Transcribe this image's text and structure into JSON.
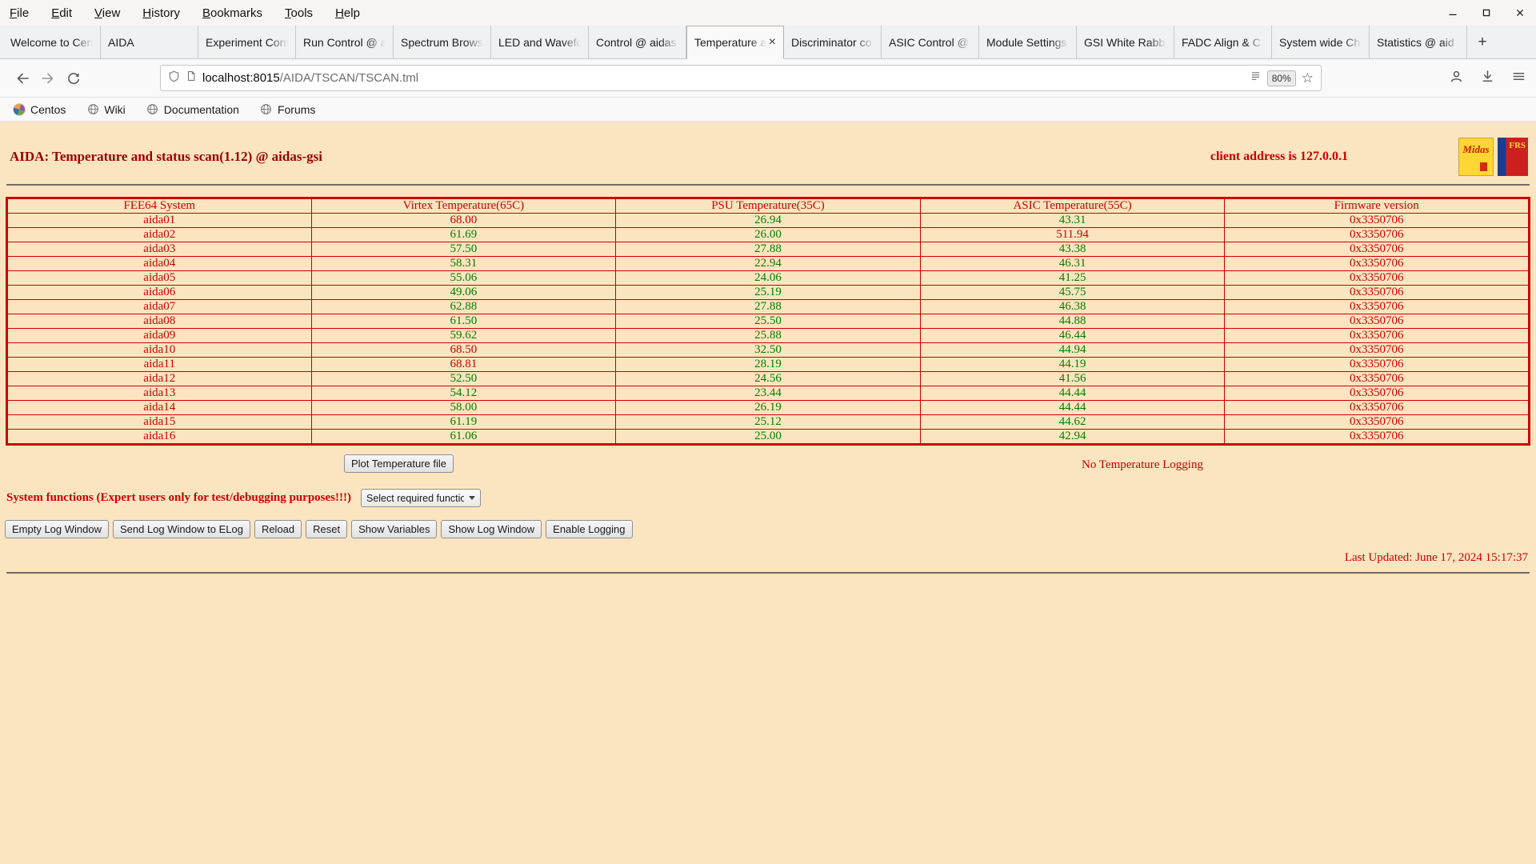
{
  "browser": {
    "menubar": {
      "items": [
        "File",
        "Edit",
        "View",
        "History",
        "Bookmarks",
        "Tools",
        "Help"
      ]
    },
    "tabs": [
      {
        "label": "Welcome to Cent",
        "active": false
      },
      {
        "label": "AIDA",
        "active": false
      },
      {
        "label": "Experiment Cont",
        "active": false
      },
      {
        "label": "Run Control @ a",
        "active": false
      },
      {
        "label": "Spectrum Brows",
        "active": false
      },
      {
        "label": "LED and Wavefo",
        "active": false
      },
      {
        "label": "Control @ aidas",
        "active": false
      },
      {
        "label": "Temperature an",
        "active": true
      },
      {
        "label": "Discriminator co",
        "active": false
      },
      {
        "label": "ASIC Control @",
        "active": false
      },
      {
        "label": "Module Settings",
        "active": false
      },
      {
        "label": "GSI White Rabb",
        "active": false
      },
      {
        "label": "FADC Align & C",
        "active": false
      },
      {
        "label": "System wide Ch",
        "active": false
      },
      {
        "label": "Statistics @ aid",
        "active": false
      }
    ],
    "new_tab_label": "+",
    "navbar": {
      "url_host": "localhost:8015",
      "url_path": "/AIDA/TSCAN/TSCAN.tml",
      "zoom": "80%"
    },
    "bookmarks": [
      {
        "label": "Centos",
        "icon": "centos"
      },
      {
        "label": "Wiki",
        "icon": "globe"
      },
      {
        "label": "Documentation",
        "icon": "globe"
      },
      {
        "label": "Forums",
        "icon": "globe"
      }
    ]
  },
  "page": {
    "title": "AIDA: Temperature and status scan(1.12) @ aidas-gsi",
    "client_address": "client address is 127.0.0.1",
    "logos": {
      "midas": "Midas",
      "frs": "FRS"
    },
    "table": {
      "headers": [
        "FEE64 System",
        "Virtex Temperature(65C)",
        "PSU Temperature(35C)",
        "ASIC Temperature(55C)",
        "Firmware version"
      ],
      "thresholds": {
        "virtex": 65,
        "psu": 35,
        "asic": 55
      },
      "rows": [
        {
          "name": "aida01",
          "virtex": "68.00",
          "psu": "26.94",
          "asic": "43.31",
          "firmware": "0x3350706"
        },
        {
          "name": "aida02",
          "virtex": "61.69",
          "psu": "26.00",
          "asic": "511.94",
          "firmware": "0x3350706"
        },
        {
          "name": "aida03",
          "virtex": "57.50",
          "psu": "27.88",
          "asic": "43.38",
          "firmware": "0x3350706"
        },
        {
          "name": "aida04",
          "virtex": "58.31",
          "psu": "22.94",
          "asic": "46.31",
          "firmware": "0x3350706"
        },
        {
          "name": "aida05",
          "virtex": "55.06",
          "psu": "24.06",
          "asic": "41.25",
          "firmware": "0x3350706"
        },
        {
          "name": "aida06",
          "virtex": "49.06",
          "psu": "25.19",
          "asic": "45.75",
          "firmware": "0x3350706"
        },
        {
          "name": "aida07",
          "virtex": "62.88",
          "psu": "27.88",
          "asic": "46.38",
          "firmware": "0x3350706"
        },
        {
          "name": "aida08",
          "virtex": "61.50",
          "psu": "25.50",
          "asic": "44.88",
          "firmware": "0x3350706"
        },
        {
          "name": "aida09",
          "virtex": "59.62",
          "psu": "25.88",
          "asic": "46.44",
          "firmware": "0x3350706"
        },
        {
          "name": "aida10",
          "virtex": "68.50",
          "psu": "32.50",
          "asic": "44.94",
          "firmware": "0x3350706"
        },
        {
          "name": "aida11",
          "virtex": "68.81",
          "psu": "28.19",
          "asic": "44.19",
          "firmware": "0x3350706"
        },
        {
          "name": "aida12",
          "virtex": "52.50",
          "psu": "24.56",
          "asic": "41.56",
          "firmware": "0x3350706"
        },
        {
          "name": "aida13",
          "virtex": "54.12",
          "psu": "23.44",
          "asic": "44.44",
          "firmware": "0x3350706"
        },
        {
          "name": "aida14",
          "virtex": "58.00",
          "psu": "26.19",
          "asic": "44.44",
          "firmware": "0x3350706"
        },
        {
          "name": "aida15",
          "virtex": "61.19",
          "psu": "25.12",
          "asic": "44.62",
          "firmware": "0x3350706"
        },
        {
          "name": "aida16",
          "virtex": "61.06",
          "psu": "25.00",
          "asic": "42.94",
          "firmware": "0x3350706"
        }
      ]
    },
    "plot_button": "Plot Temperature file",
    "logging_status": "No Temperature Logging",
    "system_functions_label": "System functions (Expert users only for test/debugging purposes!!!)",
    "function_select": "Select required function",
    "action_buttons": [
      "Empty Log Window",
      "Send Log Window to ELog",
      "Reload",
      "Reset",
      "Show Variables",
      "Show Log Window",
      "Enable Logging"
    ],
    "last_updated": "Last Updated: June 17, 2024 15:17:37",
    "colors": {
      "background": "#fbe5c0",
      "red": "#cc0000",
      "green": "#008000",
      "title": "#990000"
    }
  }
}
